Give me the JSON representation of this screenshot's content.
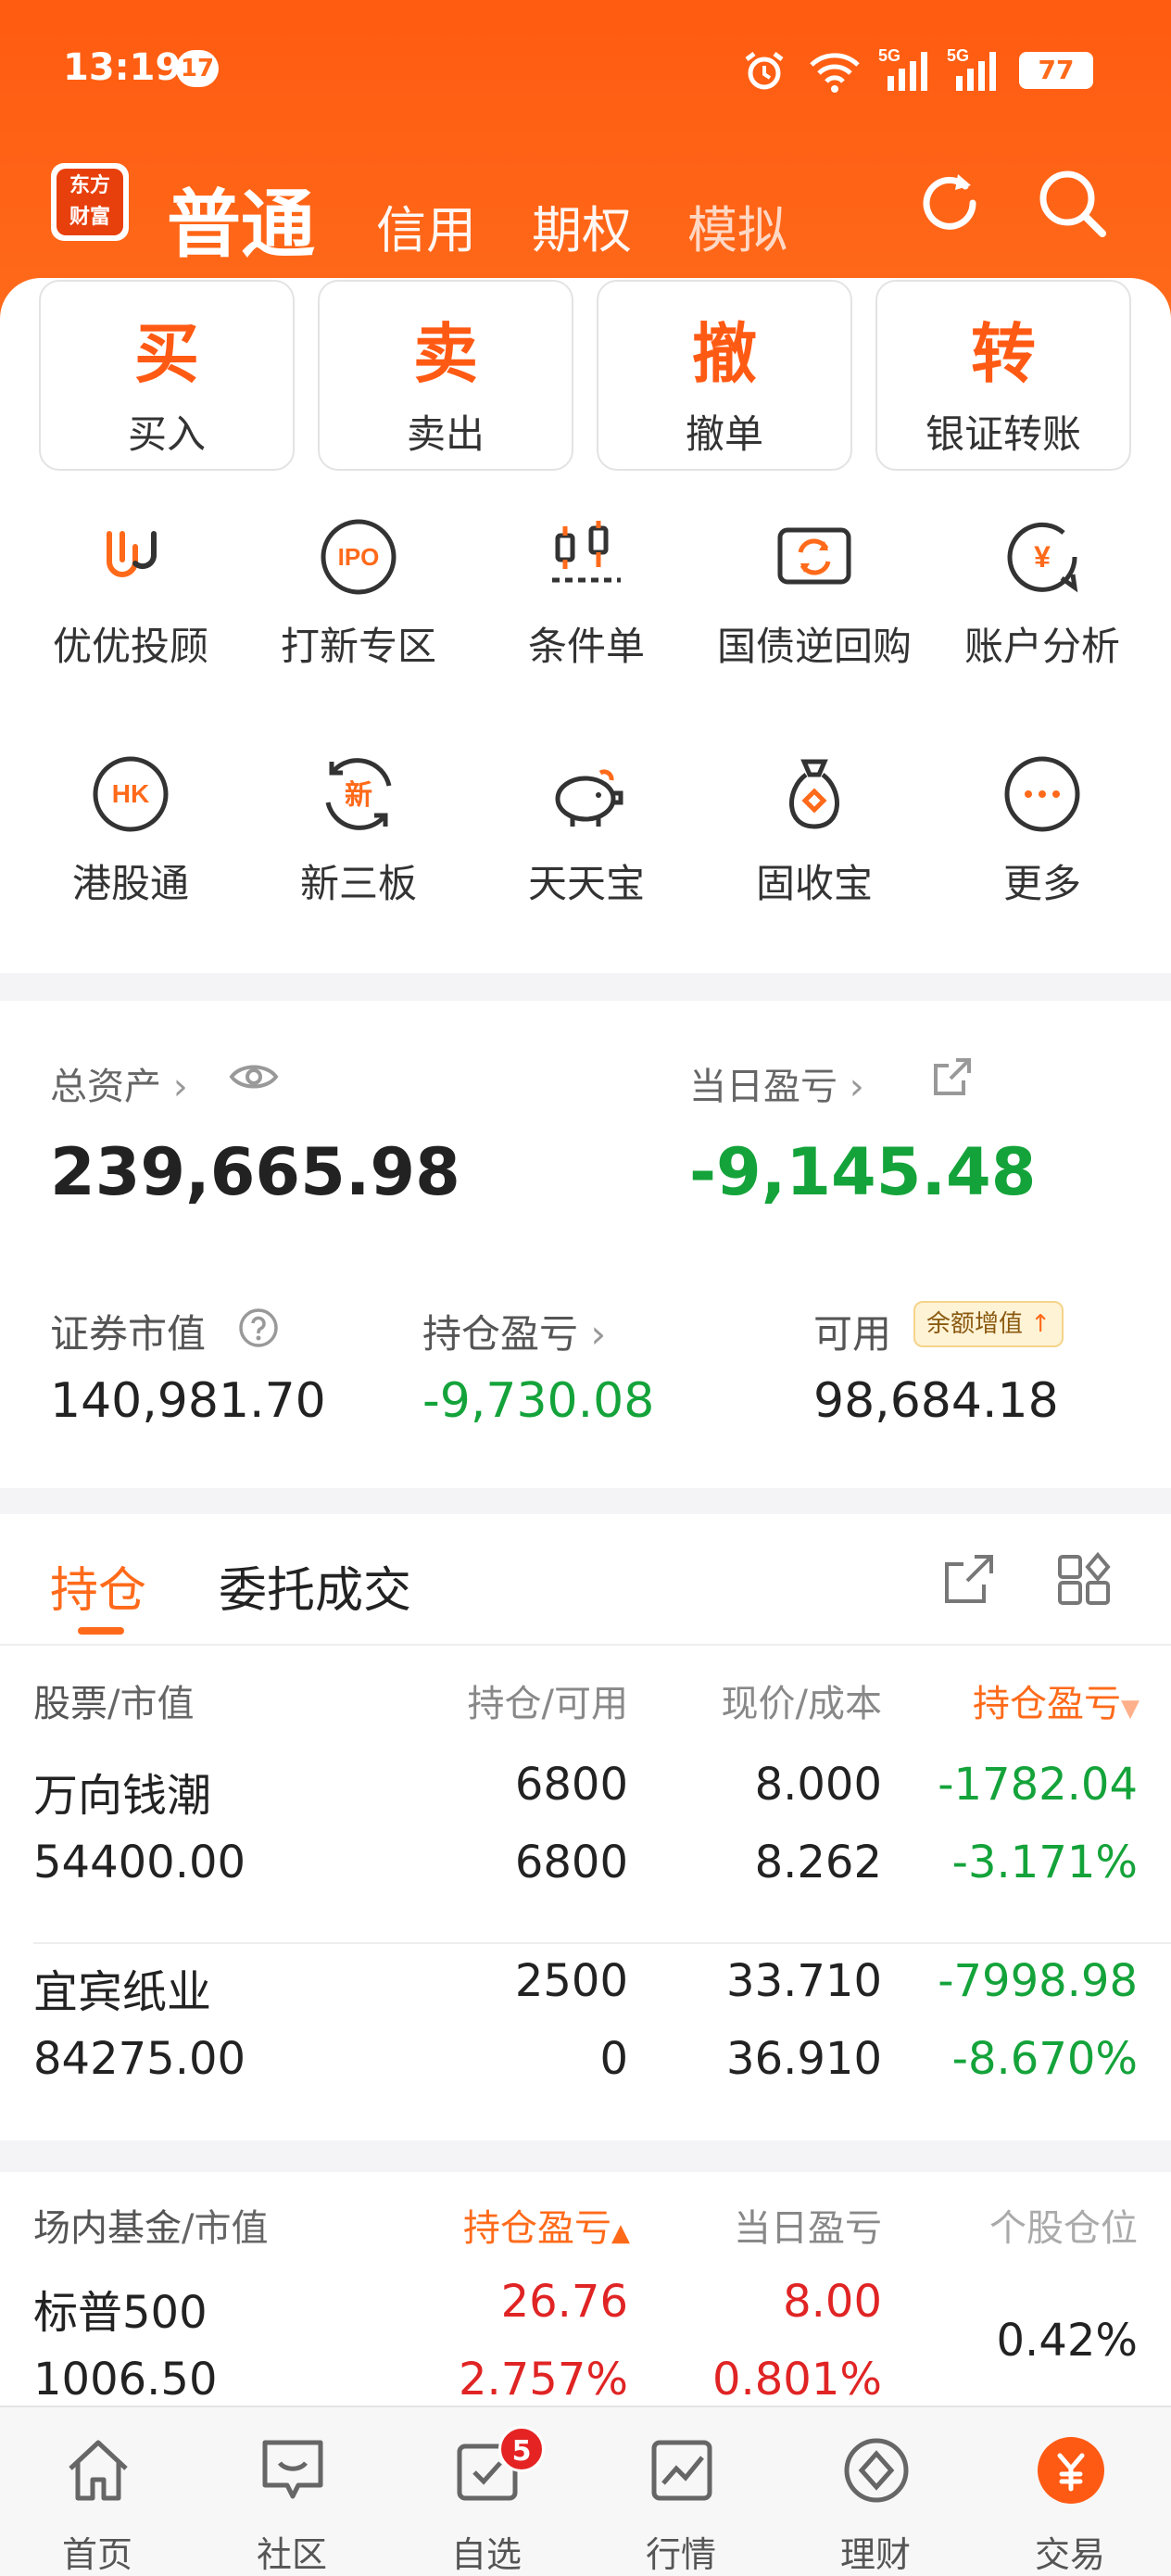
{
  "status": {
    "time": "13:19",
    "notif_count": "17",
    "battery": "77"
  },
  "header": {
    "logo_text_1": "东方",
    "logo_text_2": "财富",
    "tabs": [
      "普通",
      "信用",
      "期权",
      "模拟"
    ]
  },
  "quick_actions": [
    {
      "big": "买",
      "label": "买入"
    },
    {
      "big": "卖",
      "label": "卖出"
    },
    {
      "big": "撤",
      "label": "撤单"
    },
    {
      "big": "转",
      "label": "银证转账"
    }
  ],
  "services": [
    {
      "icon": "uu-advisor-icon",
      "label": "优优投顾"
    },
    {
      "icon": "ipo-icon",
      "label": "打新专区"
    },
    {
      "icon": "condition-order-icon",
      "label": "条件单"
    },
    {
      "icon": "repo-icon",
      "label": "国债逆回购"
    },
    {
      "icon": "account-analysis-icon",
      "label": "账户分析"
    },
    {
      "icon": "hk-connect-icon",
      "label": "港股通"
    },
    {
      "icon": "new-third-board-icon",
      "label": "新三板"
    },
    {
      "icon": "piggy-bank-icon",
      "label": "天天宝"
    },
    {
      "icon": "money-bag-icon",
      "label": "固收宝"
    },
    {
      "icon": "more-icon",
      "label": "更多"
    }
  ],
  "assets": {
    "total_label": "总资产",
    "total_value": "239,665.98",
    "daily_pl_label": "当日盈亏",
    "daily_pl_value": "-9,145.48",
    "market_value_label": "证券市值",
    "market_value": "140,981.70",
    "position_pl_label": "持仓盈亏",
    "position_pl": "-9,730.08",
    "available_label": "可用",
    "available_badge": "余额增值",
    "available_value": "98,684.18"
  },
  "holdings": {
    "tabs": [
      "持仓",
      "委托成交"
    ],
    "headers": {
      "stock": "股票",
      "stock_sub": "/市值",
      "qty": "持仓/可用",
      "price": "现价/成本",
      "pl": "持仓盈亏"
    },
    "rows": [
      {
        "name": "万向钱潮",
        "mv": "54400.00",
        "pos": "6800",
        "avail": "6800",
        "price": "8.000",
        "cost": "8.262",
        "pl": "-1782.04",
        "plpct": "-3.171%"
      },
      {
        "name": "宜宾纸业",
        "mv": "84275.00",
        "pos": "2500",
        "avail": "0",
        "price": "33.710",
        "cost": "36.910",
        "pl": "-7998.98",
        "plpct": "-8.670%"
      }
    ]
  },
  "funds": {
    "headers": {
      "fund": "场内基金",
      "fund_sub": "/市值",
      "pl": "持仓盈亏",
      "daily": "当日盈亏",
      "weight": "个股仓位"
    },
    "rows": [
      {
        "name": "标普500",
        "mv": "1006.50",
        "pl": "26.76",
        "plpct": "2.757%",
        "daily": "8.00",
        "dailypct": "0.801%",
        "weight": "0.42%"
      }
    ]
  },
  "bottom_nav": [
    {
      "icon": "home-icon",
      "label": "首页"
    },
    {
      "icon": "community-icon",
      "label": "社区"
    },
    {
      "icon": "watchlist-icon",
      "label": "自选",
      "badge": "5"
    },
    {
      "icon": "market-icon",
      "label": "行情"
    },
    {
      "icon": "wealth-icon",
      "label": "理财"
    },
    {
      "icon": "trade-icon",
      "label": "交易"
    }
  ],
  "colors": {
    "accent": "#ff6a1a",
    "up": "#e02424",
    "down": "#14a33a"
  }
}
